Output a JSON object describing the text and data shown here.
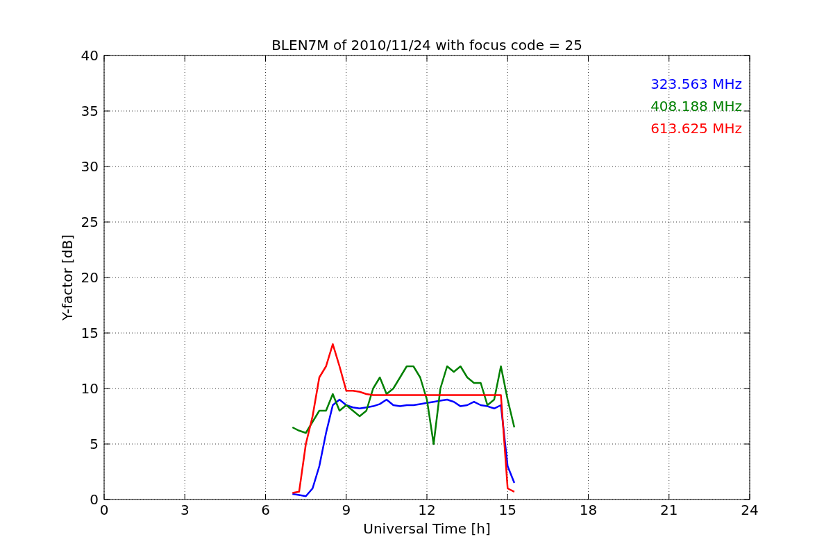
{
  "chart_data": {
    "type": "line",
    "title": "BLEN7M of 2010/11/24 with focus code = 25",
    "xlabel": "Universal Time [h]",
    "ylabel": "Y-factor [dB]",
    "x": [
      7,
      7.25,
      7.5,
      7.75,
      8,
      8.25,
      8.5,
      8.75,
      9,
      9.25,
      9.5,
      9.75,
      10,
      10.25,
      10.5,
      10.75,
      11,
      11.25,
      11.5,
      11.75,
      12,
      12.25,
      12.5,
      12.75,
      13,
      13.25,
      13.5,
      13.75,
      14,
      14.25,
      14.5,
      14.75,
      15,
      15.25
    ],
    "series": [
      {
        "name": "323.563 MHz",
        "color": "#0000ff",
        "values": [
          0.5,
          0.4,
          0.3,
          1,
          3,
          6,
          8.5,
          9,
          8.5,
          8.3,
          8.2,
          8.3,
          8.4,
          8.6,
          9,
          8.5,
          8.4,
          8.5,
          8.5,
          8.6,
          8.7,
          8.8,
          8.9,
          9,
          8.8,
          8.4,
          8.5,
          8.8,
          8.5,
          8.4,
          8.2,
          8.5,
          3,
          1.5
        ]
      },
      {
        "name": "408.188 MHz",
        "color": "#008000",
        "values": [
          6.5,
          6.2,
          6,
          7,
          8,
          8,
          9.5,
          8,
          8.5,
          8,
          7.5,
          8,
          10,
          11,
          9.5,
          10,
          11,
          12,
          12,
          11,
          9,
          5,
          10,
          12,
          11.5,
          12,
          11,
          10.5,
          10.5,
          8.5,
          9,
          12,
          9,
          6.5
        ]
      },
      {
        "name": "613.625 MHz",
        "color": "#ff0000",
        "values": [
          0.6,
          0.7,
          5,
          7.5,
          11,
          12,
          14,
          12,
          9.8,
          9.8,
          9.7,
          9.5,
          9.4,
          9.4,
          9.4,
          9.4,
          9.4,
          9.4,
          9.4,
          9.4,
          9.4,
          9.4,
          9.4,
          9.4,
          9.4,
          9.4,
          9.4,
          9.4,
          9.4,
          9.4,
          9.4,
          9.4,
          1,
          0.7
        ]
      }
    ],
    "xlim": [
      0,
      24
    ],
    "ylim": [
      0,
      40
    ],
    "xticks": [
      0,
      3,
      6,
      9,
      12,
      15,
      18,
      21,
      24
    ],
    "yticks": [
      0,
      5,
      10,
      15,
      20,
      25,
      30,
      35,
      40
    ],
    "grid": true
  }
}
